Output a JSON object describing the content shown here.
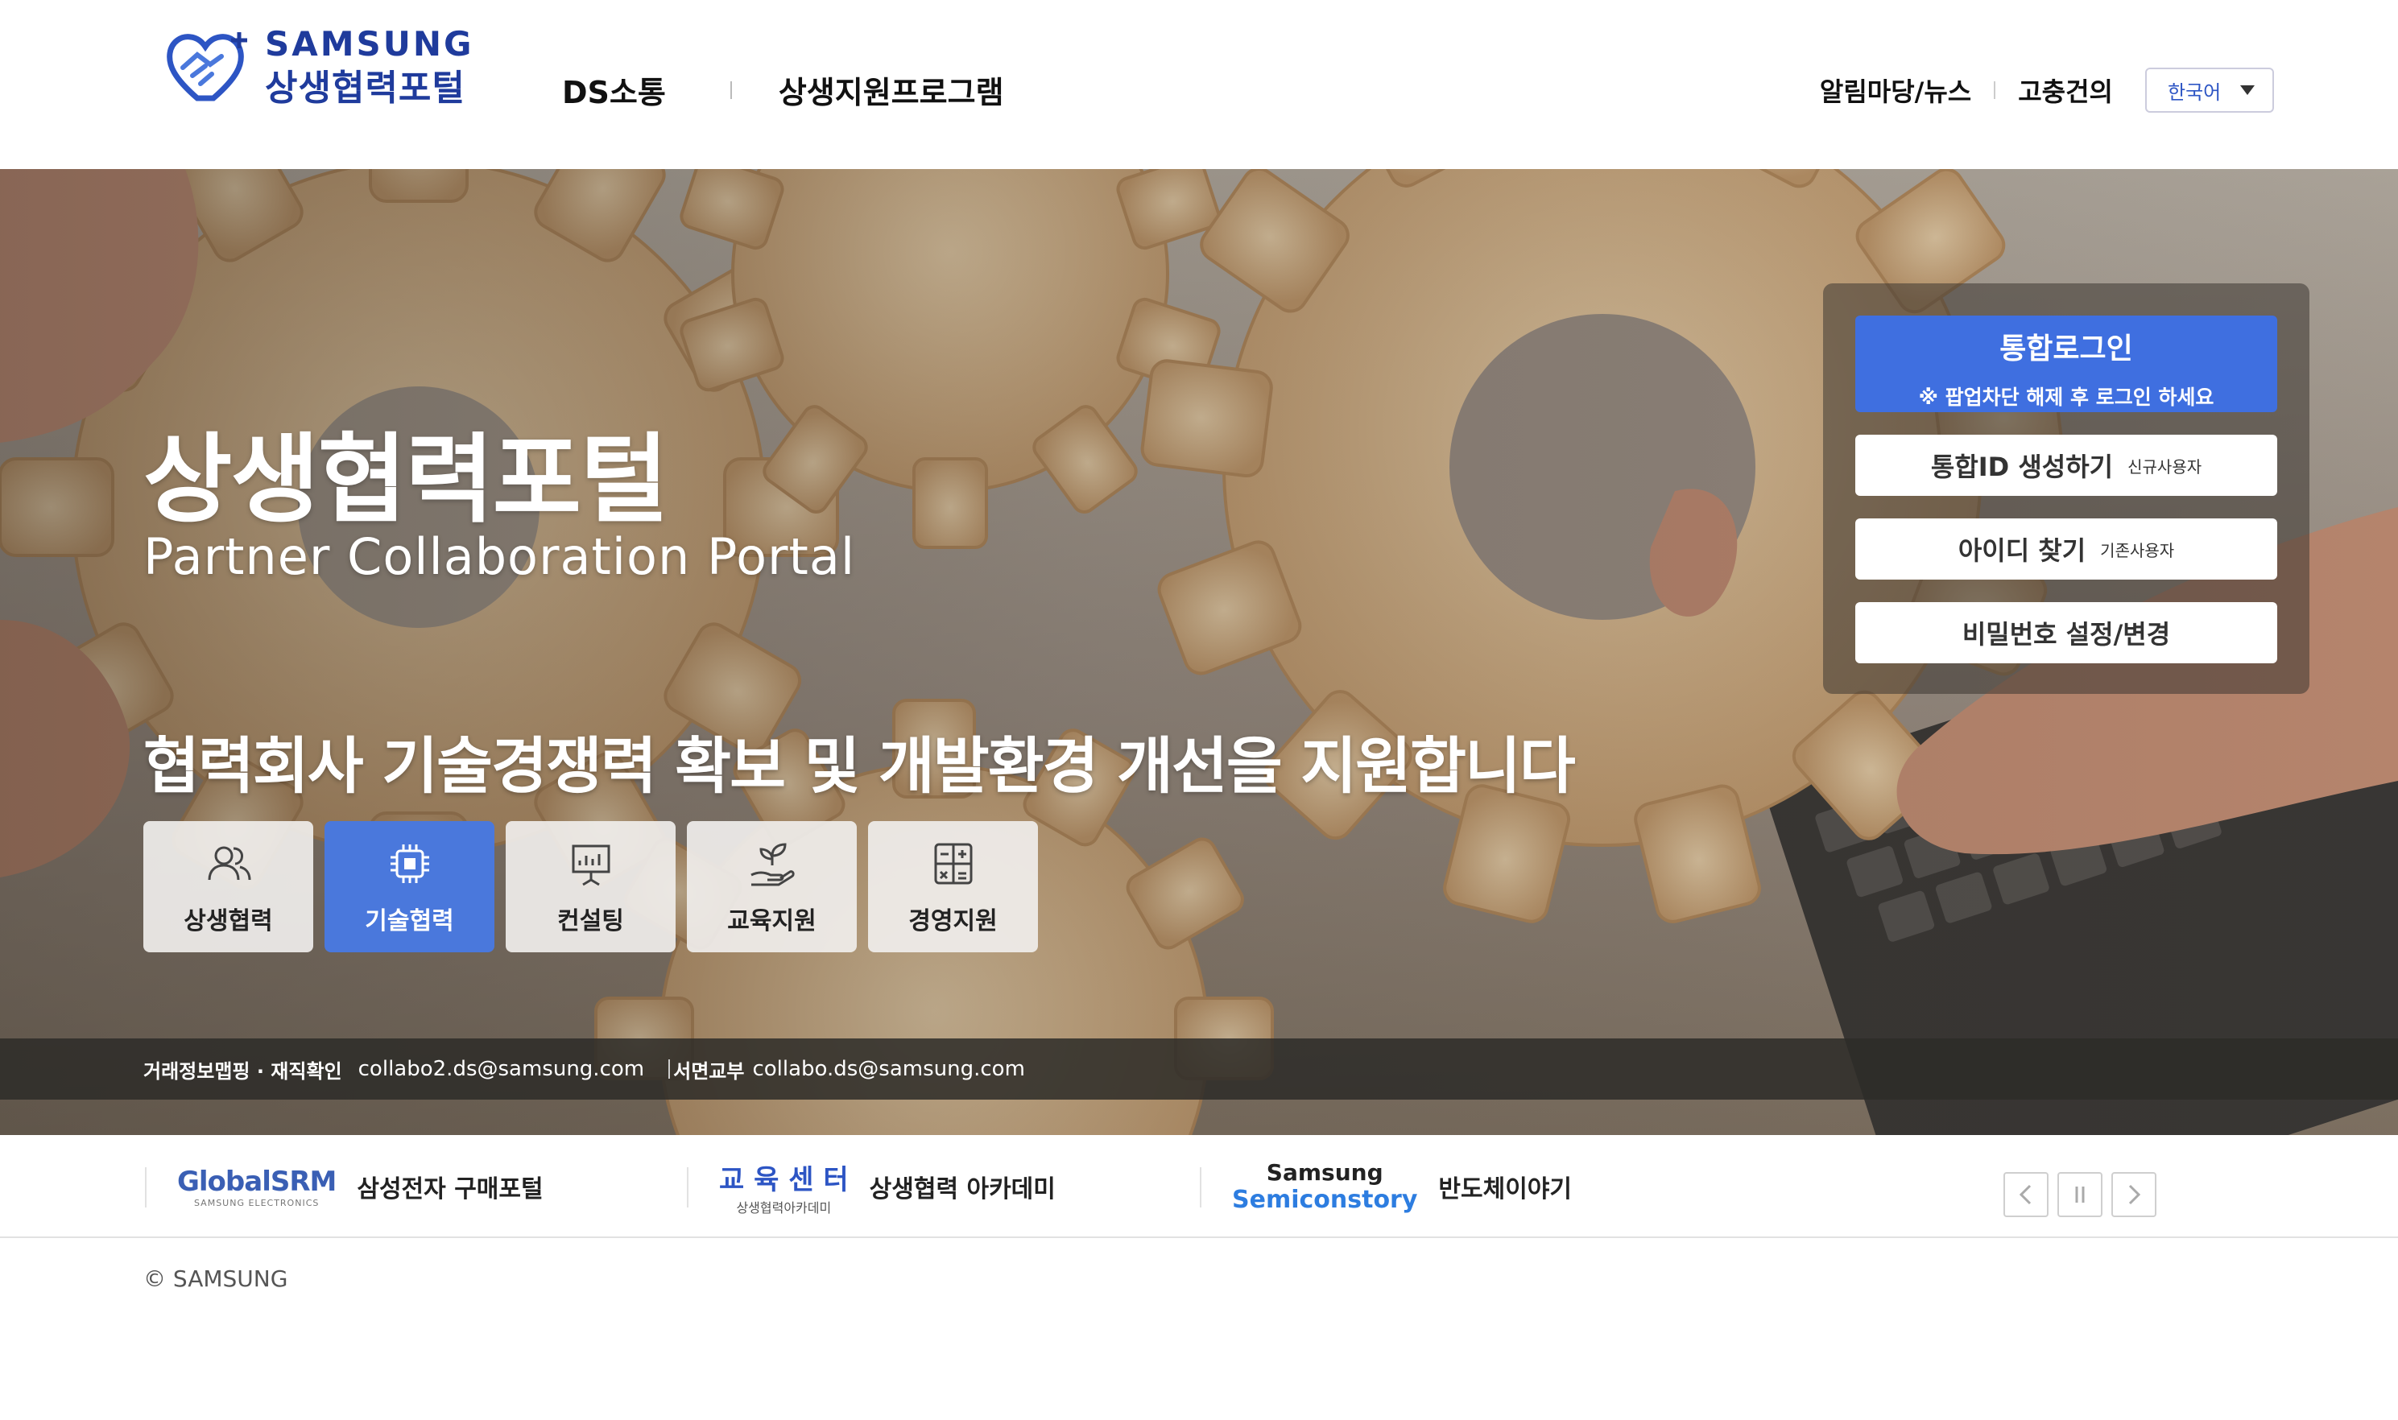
{
  "header": {
    "logo": {
      "brand": "SAMSUNG",
      "sub": "상생협력포털"
    },
    "nav": [
      "DS소통",
      "상생지원프로그램"
    ],
    "util": [
      "알림마당/뉴스",
      "고충건의"
    ],
    "language": "한국어"
  },
  "hero": {
    "title": "상생협력포털",
    "subtitle": "Partner Collaboration Portal",
    "description": "협력회사 기술경쟁력 확보 및 개발환경 개선을 지원합니다",
    "cards": [
      {
        "label": "상생협력",
        "icon": "people-icon",
        "active": false
      },
      {
        "label": "기술협력",
        "icon": "chip-icon",
        "active": true
      },
      {
        "label": "컨설팅",
        "icon": "presentation-icon",
        "active": false
      },
      {
        "label": "교육지원",
        "icon": "plant-hand-icon",
        "active": false
      },
      {
        "label": "경영지원",
        "icon": "calculator-icon",
        "active": false
      }
    ],
    "contact": {
      "label1": "거래정보맵핑 · 재직확인",
      "email1": "collabo2.ds@samsung.com",
      "label2": "서면교부",
      "email2": "collabo.ds@samsung.com"
    }
  },
  "login": {
    "title": "통합로그인",
    "notice": "※ 팝업차단 해제 후 로그인 하세요",
    "create": {
      "label": "통합ID 생성하기",
      "sub": "신규사용자"
    },
    "find": {
      "label": "아이디 찾기",
      "sub": "기존사용자"
    },
    "password": {
      "label": "비밀번호 설정/변경"
    }
  },
  "family": [
    {
      "logo_top": "GlobalSRM",
      "logo_bottom": "SAMSUNG ELECTRONICS",
      "text": "삼성전자 구매포털"
    },
    {
      "logo_top": "교 육 센 터",
      "logo_bottom": "상생협력아카데미",
      "text": "상생협력 아카데미"
    },
    {
      "logo_top": "Samsung",
      "logo_bottom": "Semiconstory",
      "text": "반도체이야기"
    }
  ],
  "footer": {
    "copyright": "© SAMSUNG"
  },
  "colors": {
    "brand": "#1f3b9c",
    "accent": "#3f6fe0",
    "card_active": "#4a78dc"
  }
}
